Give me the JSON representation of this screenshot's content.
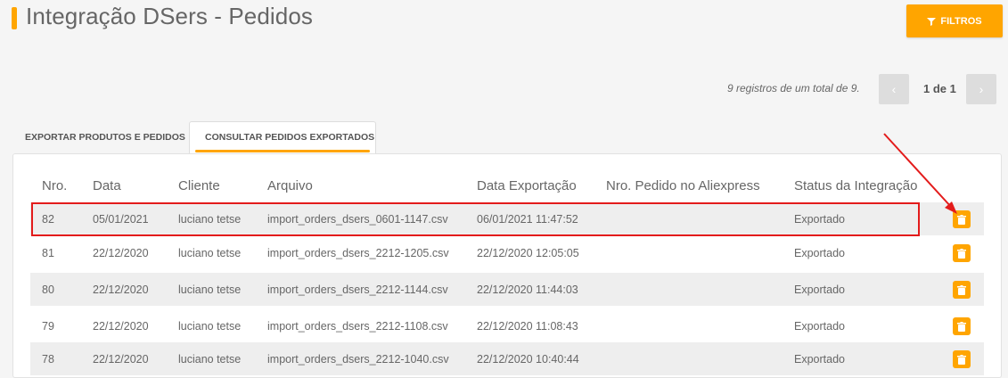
{
  "page": {
    "title": "Integração DSers - Pedidos",
    "filter_label": "FILTROS",
    "accent_color": "#ffa500",
    "highlight_color": "#e31b1b"
  },
  "pagination": {
    "summary": "9 registros de um total de 9.",
    "page_label": "1 de 1",
    "prev_icon": "chevron-left-icon",
    "next_icon": "chevron-right-icon"
  },
  "tabs": [
    {
      "label": "EXPORTAR PRODUTOS E PEDIDOS",
      "active": false
    },
    {
      "label": "CONSULTAR PEDIDOS EXPORTADOS",
      "active": true
    }
  ],
  "table": {
    "headers": [
      "Nro.",
      "Data",
      "Cliente",
      "Arquivo",
      "Data Exportação",
      "Nro. Pedido no Aliexpress",
      "Status da Integração"
    ],
    "rows": [
      [
        "82",
        "05/01/2021",
        "luciano tetse",
        "import_orders_dsers_0601-1147.csv",
        "06/01/2021 11:47:52",
        "",
        "Exportado"
      ],
      [
        "81",
        "22/12/2020",
        "luciano tetse",
        "import_orders_dsers_2212-1205.csv",
        "22/12/2020 12:05:05",
        "",
        "Exportado"
      ],
      [
        "80",
        "22/12/2020",
        "luciano tetse",
        "import_orders_dsers_2212-1144.csv",
        "22/12/2020 11:44:03",
        "",
        "Exportado"
      ],
      [
        "79",
        "22/12/2020",
        "luciano tetse",
        "import_orders_dsers_2212-1108.csv",
        "22/12/2020 11:08:43",
        "",
        "Exportado"
      ],
      [
        "78",
        "22/12/2020",
        "luciano tetse",
        "import_orders_dsers_2212-1040.csv",
        "22/12/2020 10:40:44",
        "",
        "Exportado"
      ]
    ],
    "row_action_icon": "trash-icon"
  }
}
